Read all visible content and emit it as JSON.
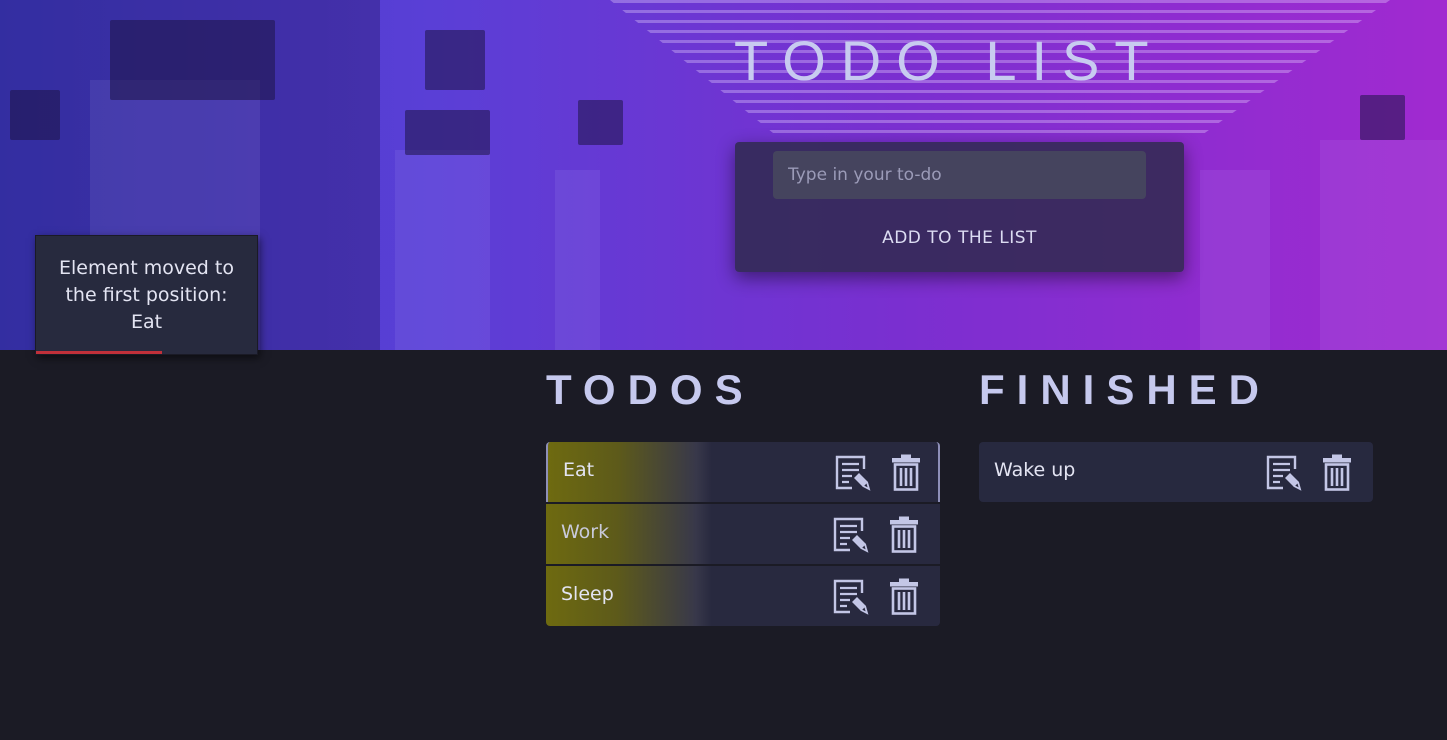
{
  "app": {
    "title": "TODO LIST"
  },
  "form": {
    "placeholder": "Type in your to-do",
    "value": "",
    "add_label": "ADD TO THE LIST"
  },
  "toast": {
    "message": "Element moved to the first position: Eat",
    "progress_fraction": 0.57,
    "progress_color": "#c0303a"
  },
  "todos": {
    "title": "TODOS",
    "items": [
      {
        "label": "Eat"
      },
      {
        "label": "Work"
      },
      {
        "label": "Sleep"
      }
    ]
  },
  "finished": {
    "title": "FINISHED",
    "items": [
      {
        "label": "Wake up"
      }
    ]
  },
  "icons": {
    "edit": "edit-note-icon",
    "delete": "trash-icon"
  },
  "colors": {
    "background": "#1b1b25",
    "hero_gradient_start": "#3f3cc8",
    "hero_gradient_end": "#a12ad0",
    "item_accent": "#6e6a10",
    "text": "#c6c9ee"
  }
}
